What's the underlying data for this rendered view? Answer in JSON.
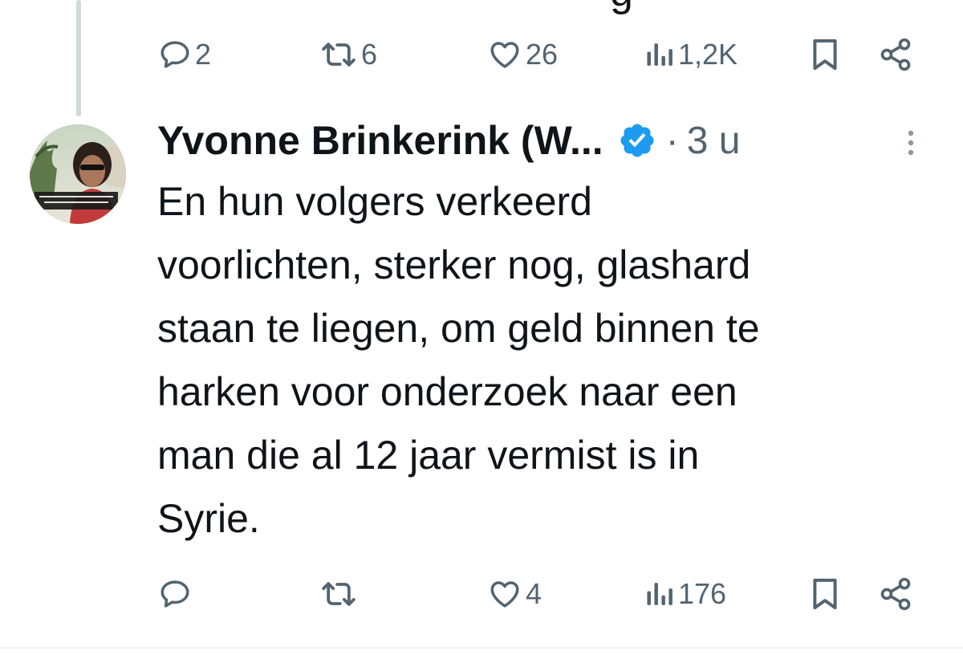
{
  "previous_tweet": {
    "clipped_text": "g",
    "actions": {
      "replies": "2",
      "reposts": "6",
      "likes": "26",
      "views": "1,2K"
    }
  },
  "tweet": {
    "author_name": "Yvonne Brinkerink (W...",
    "separator": "·",
    "timestamp": "3 u",
    "text": "En hun volgers verkeerd\nvoorlichten, sterker nog, glashard\nstaan te liegen, om geld binnen te\nharken voor onderzoek naar een\nman die al 12 jaar vermist is in\nSyrie.",
    "avatar_caption": "When injustice becomes law resistance becomes duty",
    "actions": {
      "replies": "",
      "reposts": "",
      "likes": "4",
      "views": "176"
    }
  },
  "colors": {
    "verified": "#1d9bf0",
    "muted": "#536471",
    "thread_line": "#cfd9de",
    "text": "#0f1419"
  },
  "icons": [
    "reply-icon",
    "repost-icon",
    "like-icon",
    "views-icon",
    "bookmark-icon",
    "share-icon",
    "verified-badge-icon",
    "more-options-icon"
  ]
}
